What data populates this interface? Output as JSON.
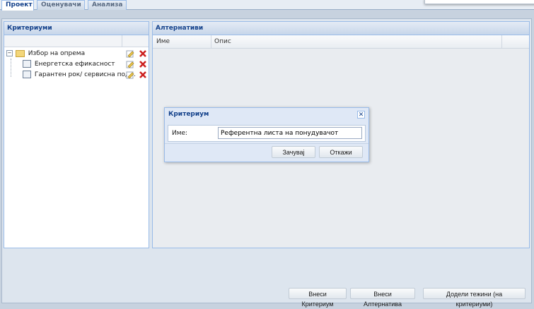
{
  "tabs": [
    {
      "label": "Проект",
      "active": true
    },
    {
      "label": "Оценувачи",
      "active": false
    },
    {
      "label": "Анализа",
      "active": false
    }
  ],
  "criteria_panel": {
    "title": "Критериуми",
    "tree": [
      {
        "label": "Избор на опрема",
        "icon": "folder-icon",
        "level": 0
      },
      {
        "label": "Енергетска ефикасност",
        "icon": "criterion-icon",
        "level": 1
      },
      {
        "label": "Гарантен рок/ сервисна под...",
        "icon": "criterion-icon",
        "level": 1
      }
    ]
  },
  "alternatives_panel": {
    "title": "Алтернативи",
    "columns": [
      "Име",
      "Опис"
    ]
  },
  "dialog": {
    "title": "Критериум",
    "name_label": "Име:",
    "name_value": "Референтна листа на понудувачот",
    "save_label": "Зачувај",
    "cancel_label": "Откажи"
  },
  "footer": {
    "add_criterion": "Внеси Критериум",
    "add_alternative": "Внеси Алтернатива",
    "assign_weights": "Додели тежини (на критериуми)"
  },
  "colors": {
    "header_text": "#15428b",
    "panel_border": "#99bbe8",
    "delete_red": "#cc2020",
    "edit_yellow": "#e8c44a"
  }
}
